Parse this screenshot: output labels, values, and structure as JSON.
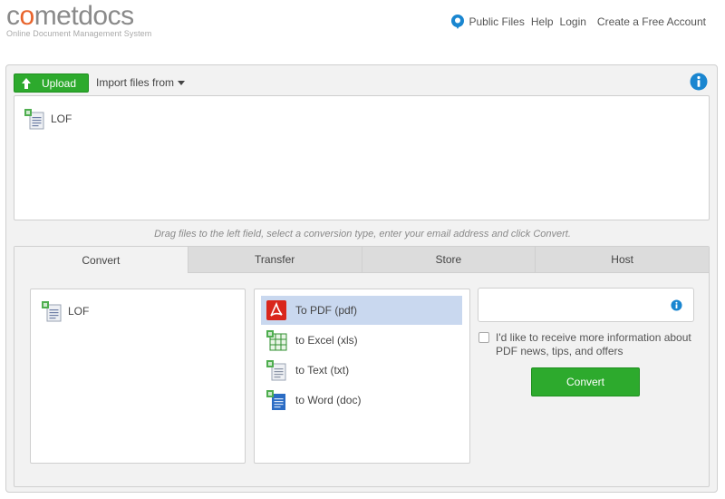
{
  "header": {
    "logo_text": "cometdocs",
    "logo_tagline": "Online Document Management System",
    "nav": {
      "public_files": "Public Files",
      "help": "Help",
      "login": "Login",
      "create_account": "Create a Free Account"
    }
  },
  "toolbar": {
    "upload_label": "Upload",
    "import_label": "Import files from"
  },
  "dropzone": {
    "files": [
      {
        "name": "LOF"
      }
    ]
  },
  "hint": "Drag files to the left field, select a conversion type, enter your email address and click Convert.",
  "tabs": [
    {
      "label": "Convert",
      "active": true
    },
    {
      "label": "Transfer",
      "active": false
    },
    {
      "label": "Store",
      "active": false
    },
    {
      "label": "Host",
      "active": false
    }
  ],
  "convert": {
    "selected_files": [
      {
        "name": "LOF"
      }
    ],
    "types": [
      {
        "label": "To PDF (pdf)",
        "icon": "pdf-icon",
        "selected": true
      },
      {
        "label": "to Excel (xls)",
        "icon": "excel-icon",
        "selected": false
      },
      {
        "label": "to Text (txt)",
        "icon": "text-icon",
        "selected": false
      },
      {
        "label": "to Word (doc)",
        "icon": "word-icon",
        "selected": false
      }
    ],
    "email_value": "",
    "email_placeholder": "",
    "optin_label": "I'd like to receive more information about PDF news, tips, and offers",
    "optin_checked": false,
    "convert_label": "Convert"
  },
  "colors": {
    "accent_green": "#2daa2d",
    "info_blue": "#1a86d0",
    "logo_orange": "#e8642c",
    "selection": "#c9d8ef"
  }
}
